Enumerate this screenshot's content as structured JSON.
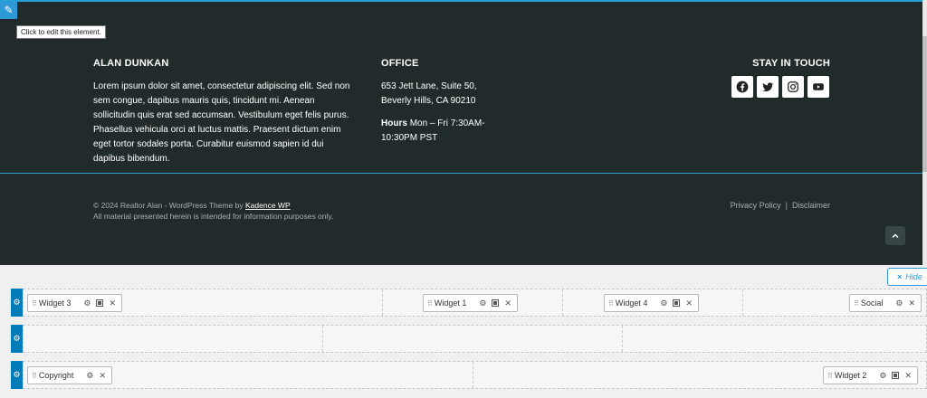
{
  "editor": {
    "tooltip": "Click to edit this element."
  },
  "footer": {
    "about": {
      "title": "ALAN DUNKAN",
      "text": "Lorem ipsum dolor sit amet, consectetur adipiscing elit. Sed non sem congue, dapibus mauris quis, tincidunt mi. Aenean sollicitudin quis erat sed accumsan. Vestibulum eget felis purus. Phasellus vehicula orci at luctus mattis. Praesent dictum enim eget tortor sodales porta. Curabitur euismod sapien id dui dapibus bibendum."
    },
    "office": {
      "title": "OFFICE",
      "address_line1": "653 Jett Lane, Suite 50,",
      "address_line2": "Beverly Hills, CA 90210",
      "hours_label": "Hours",
      "hours_value": "Mon – Fri 7:30AM-10:30PM PST"
    },
    "social": {
      "title": "STAY IN TOUCH",
      "icons": [
        "facebook-icon",
        "twitter-icon",
        "instagram-icon",
        "youtube-icon"
      ]
    },
    "copyright": {
      "prefix": "© 2024 Realtor Alan - WordPress Theme by ",
      "link": "Kadence WP",
      "line2": "All material presented herein is intended for information purposes only."
    },
    "legal": {
      "privacy": "Privacy Policy",
      "separator": "|",
      "disclaimer": "Disclaimer"
    }
  },
  "builder": {
    "hide_label": "Hide",
    "rows": [
      {
        "widgets": [
          "Widget 3",
          "Widget 1",
          "Widget 4",
          "Social"
        ]
      },
      {
        "widgets": []
      },
      {
        "widgets": [
          "Copyright",
          "Widget 2"
        ]
      }
    ]
  },
  "colors": {
    "footer_bg": "#222b2b",
    "accent": "#2a9fd6",
    "builder_blue": "#007cba",
    "muted_text": "#a8b0b0"
  }
}
